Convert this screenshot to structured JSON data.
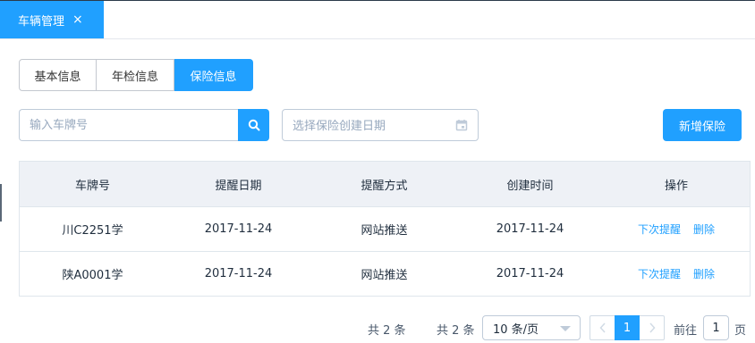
{
  "tabs": [
    {
      "label": "车辆管理",
      "close": "×"
    }
  ],
  "segments": [
    {
      "label": "基本信息",
      "active": false
    },
    {
      "label": "年检信息",
      "active": false
    },
    {
      "label": "保险信息",
      "active": true
    }
  ],
  "search": {
    "placeholder": "输入车牌号",
    "icon": "search-icon"
  },
  "date": {
    "placeholder": "选择保险创建日期",
    "icon": "calendar-icon"
  },
  "add_button": {
    "label": "新增保险"
  },
  "table": {
    "columns": [
      "车牌号",
      "提醒日期",
      "提醒方式",
      "创建时间",
      "操作"
    ],
    "rows": [
      {
        "plate": "川C2251学",
        "remind_date": "2017-11-24",
        "method": "网站推送",
        "created": "2017-11-24",
        "actions": [
          "下次提醒",
          "删除"
        ]
      },
      {
        "plate": "陕A0001学",
        "remind_date": "2017-11-24",
        "method": "网站推送",
        "created": "2017-11-24",
        "actions": [
          "下次提醒",
          "删除"
        ]
      }
    ]
  },
  "pagination": {
    "total_text": "共 2 条",
    "total_text2": "共 2 条",
    "page_size": "10 条/页",
    "current_page": "1",
    "goto_label": "前往",
    "goto_value": "1",
    "page_label": "页"
  },
  "colors": {
    "accent": "#20a0ff",
    "header_bg": "#eef1f6",
    "border": "#dfe6ec"
  }
}
